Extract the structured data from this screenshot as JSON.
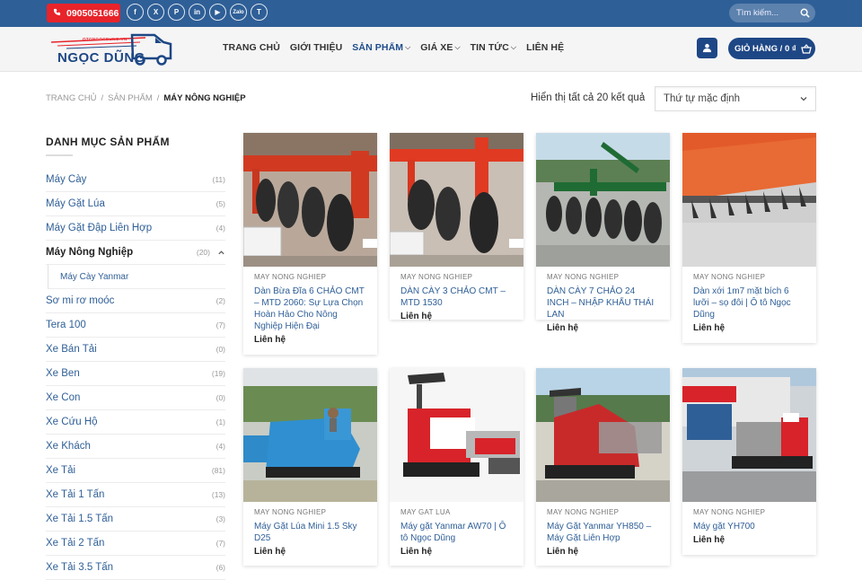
{
  "topbar": {
    "hotline": "0905051666",
    "socials": [
      "f",
      "X",
      "P",
      "in",
      "▶",
      "Zalo",
      "T"
    ],
    "search_placeholder": "Tìm kiếm..."
  },
  "header": {
    "logo_text": "NGỌC DŨNG",
    "logo_tagline": "OTONGOCDUNG.VN",
    "nav": [
      {
        "label": "TRANG CHỦ",
        "active": false,
        "dropdown": false
      },
      {
        "label": "GIỚI THIỆU",
        "active": false,
        "dropdown": false
      },
      {
        "label": "SẢN PHẨM",
        "active": true,
        "dropdown": true
      },
      {
        "label": "GIÁ XE",
        "active": false,
        "dropdown": true
      },
      {
        "label": "TIN TỨC",
        "active": false,
        "dropdown": true
      },
      {
        "label": "LIÊN HỆ",
        "active": false,
        "dropdown": false
      }
    ],
    "cart_label": "GIỎ HÀNG / 0 ₫"
  },
  "breadcrumb": {
    "items": [
      "TRANG CHỦ",
      "SẢN PHẨM"
    ],
    "current": "MÁY NÔNG NGHIỆP"
  },
  "results": {
    "count_text": "Hiển thị tất cả 20 kết quả",
    "sort_value": "Thứ tự mặc định"
  },
  "sidebar": {
    "title": "DANH MỤC SẢN PHẨM",
    "items": [
      {
        "label": "Máy Cày",
        "count": "(11)"
      },
      {
        "label": "Máy Gặt Lúa",
        "count": "(5)"
      },
      {
        "label": "Máy Gặt Đập Liên Hợp",
        "count": "(4)"
      },
      {
        "label": "Máy Nông Nghiệp",
        "count": "(20)",
        "active": true
      },
      {
        "label": "Máy Cày Yanmar",
        "sub": true
      },
      {
        "label": "Sơ mi rơ moóc",
        "count": "(2)"
      },
      {
        "label": "Tera 100",
        "count": "(7)"
      },
      {
        "label": "Xe Bán Tải",
        "count": "(0)"
      },
      {
        "label": "Xe Ben",
        "count": "(19)"
      },
      {
        "label": "Xe Con",
        "count": "(0)"
      },
      {
        "label": "Xe Cứu Hộ",
        "count": "(1)"
      },
      {
        "label": "Xe Khách",
        "count": "(4)"
      },
      {
        "label": "Xe Tải",
        "count": "(81)"
      },
      {
        "label": "Xe Tải 1 Tấn",
        "count": "(13)"
      },
      {
        "label": "Xe Tải 1.5 Tấn",
        "count": "(3)"
      },
      {
        "label": "Xe Tải 2 Tấn",
        "count": "(7)"
      },
      {
        "label": "Xe Tải 3.5 Tấn",
        "count": "(6)"
      }
    ]
  },
  "products": [
    {
      "category": "MAY NONG NGHIEP",
      "title": "Dàn Bừa Đĩa 6 CHẢO CMT – MTD 2060: Sự Lựa Chọn Hoàn Hảo Cho Nông Nghiệp Hiện Đại",
      "price": "Liên hệ",
      "image": "disc-harrow-red"
    },
    {
      "category": "MAY NONG NGHIEP",
      "title": "DÀN CÀY 3 CHẢO CMT – MTD 1530",
      "price": "Liên hệ",
      "image": "disc-plough-red"
    },
    {
      "category": "MAY NONG NGHIEP",
      "title": "DÀN CÀY 7 CHẢO 24 INCH – NHẬP KHẨU THÁI LAN",
      "price": "Liên hệ",
      "image": "disc-plough-green"
    },
    {
      "category": "MAY NONG NGHIEP",
      "title": "Dàn xới 1m7 mặt bích 6 lưỡi – sọ đôi | Ô tô Ngọc Dũng",
      "price": "Liên hệ",
      "image": "rotary-tiller"
    },
    {
      "category": "MAY NONG NGHIEP",
      "title": "Máy Gặt Lúa Mini 1.5 Sky D25",
      "price": "Liên hệ",
      "image": "mini-harvester-blue"
    },
    {
      "category": "MAY GAT LUA",
      "title": "Máy gặt Yanmar AW70 | Ô tô Ngọc Dũng",
      "price": "Liên hệ",
      "image": "harvester-red-white"
    },
    {
      "category": "MAY NONG NGHIEP",
      "title": "Máy Gặt Yanmar YH850 – Máy Gặt Liên Hợp",
      "price": "Liên hệ",
      "image": "harvester-yh850"
    },
    {
      "category": "MAY NONG NGHIEP",
      "title": "Máy gặt YH700",
      "price": "Liên hệ",
      "image": "harvester-yh700"
    }
  ]
}
